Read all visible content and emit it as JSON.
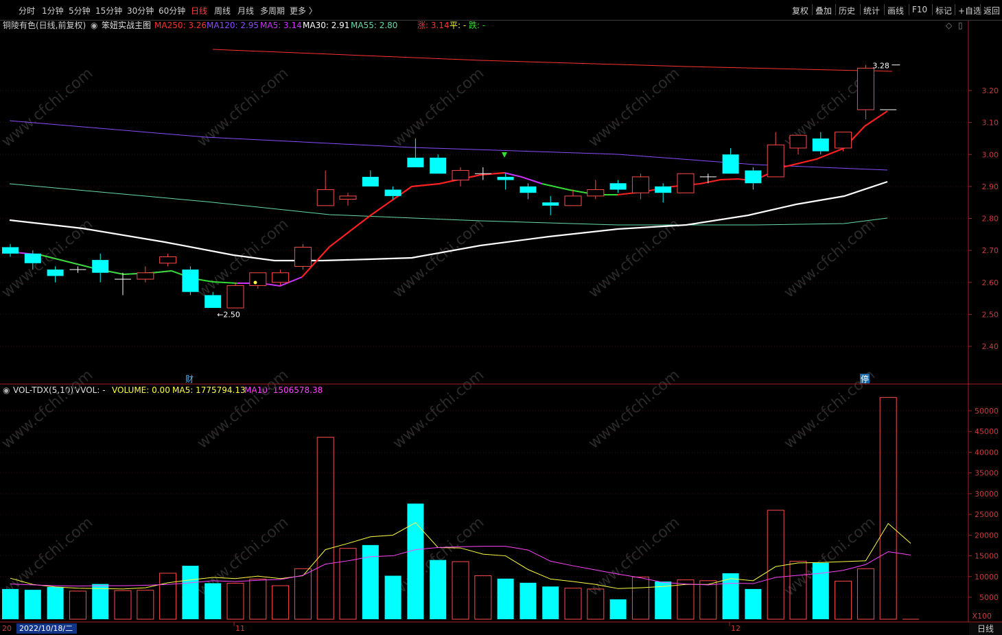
{
  "toolbar": {
    "periods": [
      "分时",
      "1分钟",
      "5分钟",
      "15分钟",
      "30分钟",
      "60分钟",
      "日线",
      "周线",
      "月线",
      "多周期",
      "更多 〉"
    ],
    "active_period": "日线",
    "right_buttons": [
      "复权",
      "叠加",
      "历史",
      "统计",
      "画线",
      "F10",
      "标记",
      "+自选",
      "返回"
    ]
  },
  "price_panel": {
    "stock_title": "铜陵有色(日线,前复权)",
    "indicator_name": "笨妞实战主图",
    "ma250": "MA250: 3.26",
    "ma120": "MA120: 2.95",
    "ma5": "MA5: 3.14",
    "ma30": "MA30: 2.91",
    "ma55": "MA55: 2.80",
    "zhang_label": "涨: 3.14",
    "ping_label": "平: -",
    "die_label": "跌: -",
    "high_marker": "3.28",
    "low_marker": "2.50",
    "event_cai": "财",
    "event_ting": "停",
    "axis_ticks": [
      "3.20",
      "3.10",
      "3.00",
      "2.90",
      "2.80",
      "2.70",
      "2.60",
      "2.50",
      "2.40"
    ],
    "colors": {
      "up": "#ff4a4a",
      "down": "#00ffff",
      "ma250": "#ff3030",
      "ma120": "#8a4cff",
      "ma5_up": "#ff2020",
      "ma5_flat": "#cc33ff",
      "ma5_down": "#33dd33",
      "ma30": "#ffffff",
      "ma55": "#66ddaa"
    }
  },
  "volume_panel": {
    "title": "VOL-TDX(5,10)",
    "vvol": "VVOL: -",
    "volume": "VOLUME: 0.00",
    "ma5": "MA5: 1775794.13",
    "ma10": "MA10: 1506578.38",
    "axis_ticks": [
      "50000",
      "45000",
      "40000",
      "35000",
      "30000",
      "25000",
      "20000",
      "15000",
      "10000",
      "5000"
    ],
    "unit": "X100"
  },
  "date_axis": {
    "left_prefix": "20",
    "selected_date": "2022/10/18/二",
    "month_11": "11",
    "month_12": "12",
    "period_button": "日线"
  },
  "watermark": "www.cfchi.com",
  "chart_data": {
    "type": "candlestick",
    "title": "铜陵有色(日线,前复权)",
    "candles": [
      {
        "o": 2.71,
        "h": 2.72,
        "l": 2.68,
        "c": 2.69
      },
      {
        "o": 2.69,
        "h": 2.7,
        "l": 2.64,
        "c": 2.66
      },
      {
        "o": 2.64,
        "h": 2.65,
        "l": 2.6,
        "c": 2.62
      },
      {
        "o": 2.64,
        "h": 2.65,
        "l": 2.63,
        "c": 2.64
      },
      {
        "o": 2.67,
        "h": 2.69,
        "l": 2.6,
        "c": 2.63
      },
      {
        "o": 2.61,
        "h": 2.63,
        "l": 2.56,
        "c": 2.61
      },
      {
        "o": 2.61,
        "h": 2.65,
        "l": 2.6,
        "c": 2.63
      },
      {
        "o": 2.66,
        "h": 2.69,
        "l": 2.65,
        "c": 2.68
      },
      {
        "o": 2.64,
        "h": 2.65,
        "l": 2.56,
        "c": 2.57
      },
      {
        "o": 2.56,
        "h": 2.57,
        "l": 2.52,
        "c": 2.52
      },
      {
        "o": 2.52,
        "h": 2.6,
        "l": 2.52,
        "c": 2.59
      },
      {
        "o": 2.59,
        "h": 2.63,
        "l": 2.58,
        "c": 2.63
      },
      {
        "o": 2.6,
        "h": 2.64,
        "l": 2.59,
        "c": 2.63
      },
      {
        "o": 2.65,
        "h": 2.72,
        "l": 2.64,
        "c": 2.71
      },
      {
        "o": 2.84,
        "h": 2.95,
        "l": 2.84,
        "c": 2.89
      },
      {
        "o": 2.86,
        "h": 2.88,
        "l": 2.84,
        "c": 2.87
      },
      {
        "o": 2.93,
        "h": 2.95,
        "l": 2.9,
        "c": 2.9
      },
      {
        "o": 2.89,
        "h": 2.9,
        "l": 2.86,
        "c": 2.87
      },
      {
        "o": 2.99,
        "h": 3.05,
        "l": 2.96,
        "c": 2.96
      },
      {
        "o": 2.99,
        "h": 3.0,
        "l": 2.94,
        "c": 2.94
      },
      {
        "o": 2.92,
        "h": 2.96,
        "l": 2.9,
        "c": 2.95
      },
      {
        "o": 2.94,
        "h": 2.96,
        "l": 2.92,
        "c": 2.94
      },
      {
        "o": 2.93,
        "h": 2.94,
        "l": 2.89,
        "c": 2.92
      },
      {
        "o": 2.9,
        "h": 2.91,
        "l": 2.86,
        "c": 2.88
      },
      {
        "o": 2.85,
        "h": 2.87,
        "l": 2.81,
        "c": 2.84
      },
      {
        "o": 2.84,
        "h": 2.89,
        "l": 2.84,
        "c": 2.87
      },
      {
        "o": 2.87,
        "h": 2.92,
        "l": 2.86,
        "c": 2.89
      },
      {
        "o": 2.91,
        "h": 2.92,
        "l": 2.88,
        "c": 2.89
      },
      {
        "o": 2.88,
        "h": 2.94,
        "l": 2.86,
        "c": 2.93
      },
      {
        "o": 2.9,
        "h": 2.91,
        "l": 2.85,
        "c": 2.88
      },
      {
        "o": 2.88,
        "h": 2.94,
        "l": 2.88,
        "c": 2.94
      },
      {
        "o": 2.93,
        "h": 2.94,
        "l": 2.91,
        "c": 2.93
      },
      {
        "o": 3.0,
        "h": 3.02,
        "l": 2.94,
        "c": 2.94
      },
      {
        "o": 2.95,
        "h": 2.96,
        "l": 2.89,
        "c": 2.91
      },
      {
        "o": 2.93,
        "h": 3.07,
        "l": 2.93,
        "c": 3.03
      },
      {
        "o": 3.02,
        "h": 3.06,
        "l": 3.0,
        "c": 3.06
      },
      {
        "o": 3.05,
        "h": 3.07,
        "l": 3.0,
        "c": 3.01
      },
      {
        "o": 3.02,
        "h": 3.07,
        "l": 3.01,
        "c": 3.07
      },
      {
        "o": 3.14,
        "h": 3.28,
        "l": 3.11,
        "c": 3.27
      },
      {
        "o": 3.14,
        "h": 3.14,
        "l": 3.14,
        "c": 3.14
      }
    ],
    "volumes": [
      7000,
      6800,
      7500,
      6500,
      8200,
      6600,
      6700,
      10800,
      12600,
      8400,
      8400,
      9400,
      7800,
      11900,
      43600,
      16800,
      17600,
      10200,
      27600,
      14000,
      13600,
      10200,
      9500,
      8500,
      7600,
      7200,
      7000,
      4500,
      9900,
      8800,
      9200,
      9000,
      10800,
      7000,
      26000,
      13700,
      13300,
      8900,
      11900,
      53200
    ],
    "vol_ma5": [
      9600,
      8100,
      7500,
      7200,
      7100,
      7000,
      7300,
      8500,
      9200,
      9800,
      9500,
      10100,
      9500,
      10200,
      16500,
      18000,
      19600,
      20000,
      23000,
      17000,
      16900,
      15400,
      15000,
      11700,
      9400,
      8800,
      8100,
      7100,
      7300,
      7600,
      8100,
      8100,
      9500,
      9000,
      12400,
      13300,
      13400,
      13600,
      13800,
      22800,
      18000
    ],
    "vol_ma10": [
      8200,
      8000,
      7800,
      7700,
      7800,
      7800,
      7900,
      8100,
      8500,
      9000,
      8800,
      9100,
      9300,
      10300,
      13000,
      13800,
      14800,
      15000,
      16500,
      17000,
      17200,
      17300,
      17300,
      16400,
      13700,
      12600,
      11600,
      10600,
      9700,
      8600,
      8200,
      8000,
      8400,
      8300,
      9800,
      10300,
      10800,
      11500,
      12900,
      16000,
      15200
    ]
  }
}
